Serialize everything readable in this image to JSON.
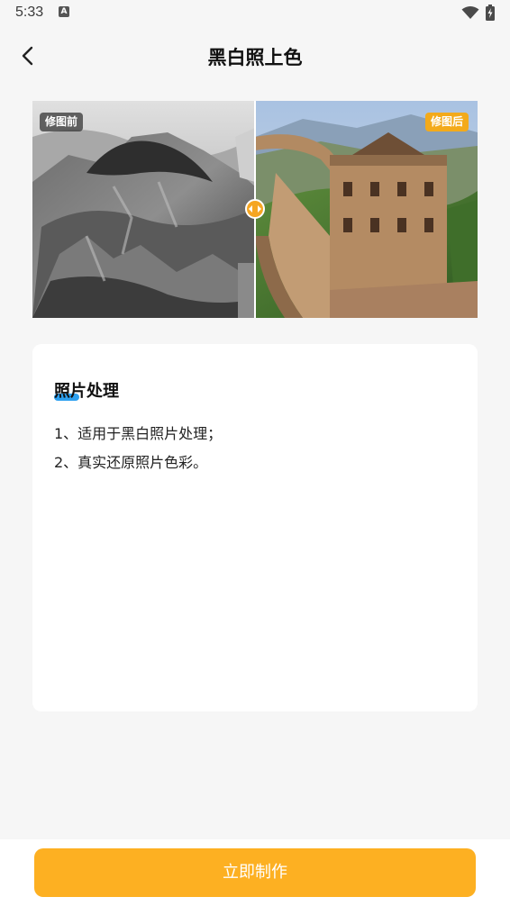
{
  "status_bar": {
    "time": "5:33",
    "notification_icon_letter": "A",
    "icons": [
      "text-notification-icon",
      "wifi-icon",
      "battery-charging-icon"
    ]
  },
  "app_bar": {
    "title": "黑白照上色",
    "back_icon": "chevron-left-icon"
  },
  "preview": {
    "before_label": "修图前",
    "after_label": "修图后",
    "slider_position": 0.5,
    "handle_color": "#f5a623",
    "after_label_color": "#f3aa1b"
  },
  "card": {
    "title": "照片处理",
    "items": [
      "1、适用于黑白照片处理；",
      "2、真实还原照片色彩。"
    ],
    "accent_color": "#2da0f0"
  },
  "action": {
    "button_label": "立即制作",
    "button_color": "#fdb022"
  }
}
